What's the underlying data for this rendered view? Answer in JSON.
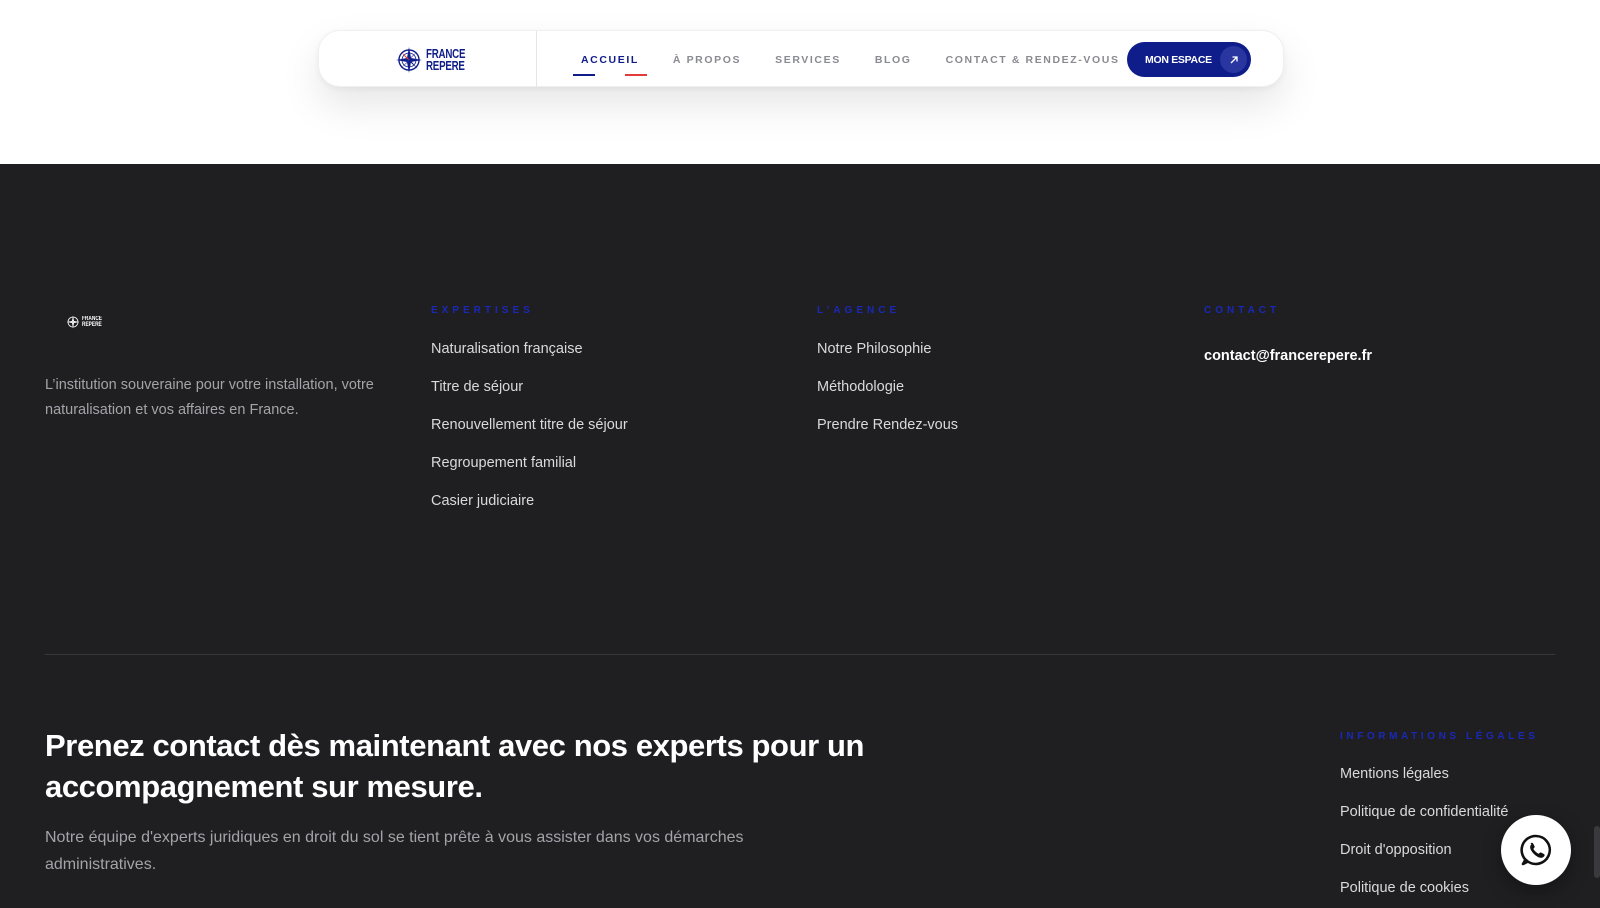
{
  "brand": {
    "logo_line1": "FRANCE",
    "logo_line2": "REPERE",
    "primary_color": "#0f1d8a",
    "accent_color": "#e43b3b"
  },
  "nav": {
    "links": [
      {
        "label": "ACCUEIL",
        "active": true
      },
      {
        "label": "À PROPOS",
        "active": false
      },
      {
        "label": "SERVICES",
        "active": false
      },
      {
        "label": "BLOG",
        "active": false
      },
      {
        "label": "CONTACT & RENDEZ-VOUS",
        "active": false
      }
    ],
    "cta_label": "MON ESPACE",
    "cta_icon": "arrow-up-right-icon"
  },
  "footer": {
    "tagline": "L’institution souveraine pour votre installation, votre naturalisation et vos affaires en France.",
    "expertises": {
      "heading": "EXPERTISES",
      "items": [
        "Naturalisation française",
        "Titre de séjour",
        "Renouvellement titre de séjour",
        "Regroupement familial",
        "Casier judiciaire"
      ]
    },
    "agence": {
      "heading": "L’AGENCE",
      "items": [
        "Notre Philosophie",
        "Méthodologie",
        "Prendre Rendez-vous"
      ]
    },
    "contact": {
      "heading": "CONTACT",
      "email": "contact@francerepere.fr"
    },
    "cta_title": "Prenez contact dès maintenant avec nos experts pour un accompagnement sur mesure.",
    "cta_text": "Notre équipe d'experts juridiques en droit du sol se tient prête à vous assister dans vos démarches administratives.",
    "legal": {
      "heading": "INFORMATIONS LÉGALES",
      "items": [
        "Mentions légales",
        "Politique de confidentialité",
        "Droit d'opposition",
        "Politique de cookies"
      ]
    },
    "whatsapp_icon": "whatsapp-icon"
  }
}
